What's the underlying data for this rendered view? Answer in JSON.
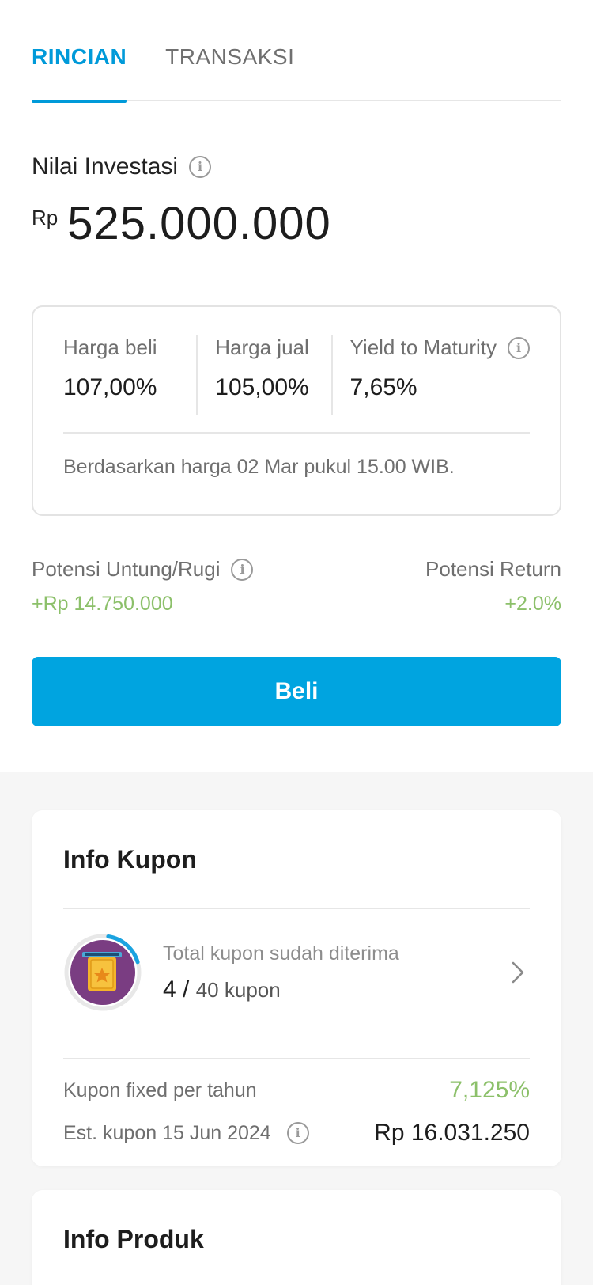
{
  "tabs": [
    {
      "label": "RINCIAN",
      "active": true
    },
    {
      "label": "TRANSAKSI",
      "active": false
    }
  ],
  "investment": {
    "label": "Nilai Investasi",
    "currency": "Rp",
    "amount": "525.000.000"
  },
  "prices": {
    "buy_label": "Harga beli",
    "buy_value": "107,00%",
    "sell_label": "Harga jual",
    "sell_value": "105,00%",
    "ytm_label": "Yield to Maturity",
    "ytm_value": "7,65%",
    "note": "Berdasarkan harga 02 Mar pukul 15.00 WIB."
  },
  "potential": {
    "pl_label": "Potensi Untung/Rugi",
    "pl_value": "+Rp 14.750.000",
    "return_label": "Potensi Return",
    "return_value": "+2.0%"
  },
  "buy_button": "Beli",
  "coupon_info": {
    "title": "Info Kupon",
    "received_label": "Total kupon sudah diterima",
    "received_count": "4",
    "separator": "/",
    "total": "40 kupon",
    "progress_fraction": 0.1,
    "fixed_label": "Kupon fixed per tahun",
    "fixed_value": "7,125%",
    "est_label": "Est. kupon 15 Jun 2024",
    "est_value": "Rp 16.031.250"
  },
  "product_info": {
    "title": "Info Produk"
  },
  "colors": {
    "accent": "#009ad9",
    "button": "#00a4e0",
    "positive": "#8cc06a",
    "coupon_bg": "#7a3d82",
    "coupon_ticket": "#f5b42a",
    "progress_ring": "#1aa3e0"
  },
  "icons": {
    "info": "info-icon",
    "chevron": "chevron-right-icon",
    "coupon": "coupon-ticket-icon"
  }
}
